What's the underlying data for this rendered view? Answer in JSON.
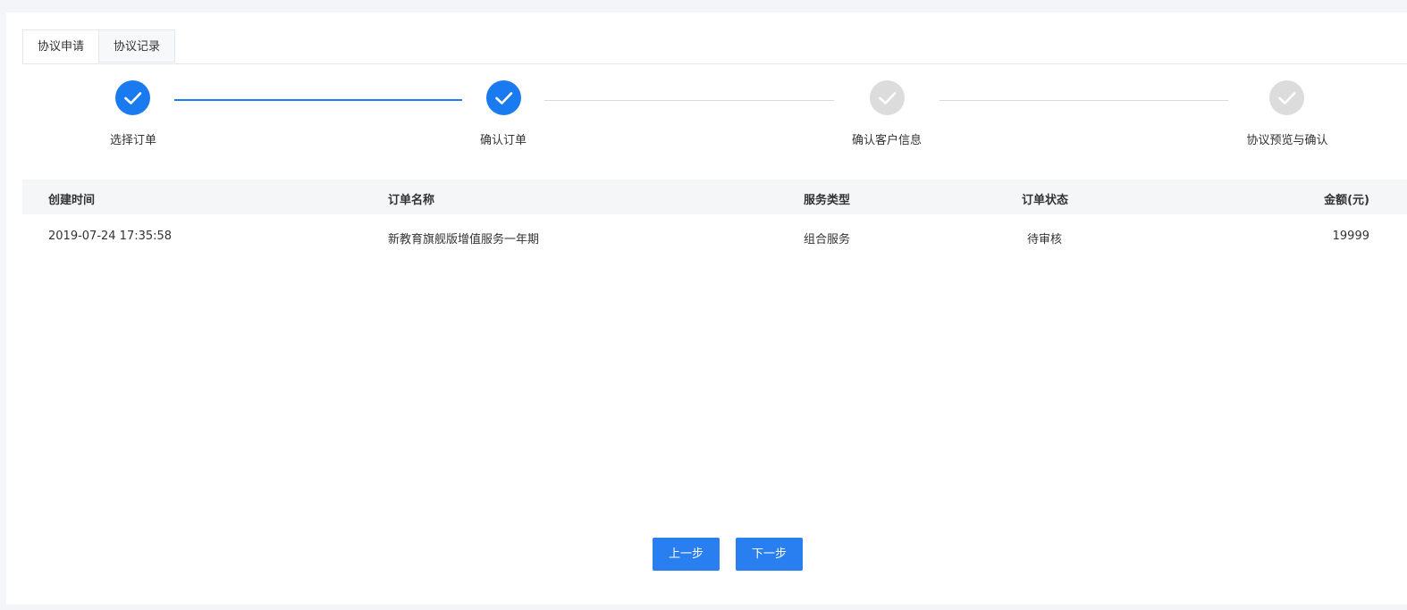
{
  "tabs": [
    {
      "label": "协议申请",
      "active": true
    },
    {
      "label": "协议记录",
      "active": false
    }
  ],
  "steps": [
    {
      "label": "选择订单",
      "status": "done"
    },
    {
      "label": "确认订单",
      "status": "done"
    },
    {
      "label": "确认客户信息",
      "status": "todo"
    },
    {
      "label": "协议预览与确认",
      "status": "todo"
    }
  ],
  "table": {
    "headers": {
      "created_time": "创建时间",
      "order_name": "订单名称",
      "service_type": "服务类型",
      "order_status": "订单状态",
      "amount": "金额(元)"
    },
    "rows": [
      {
        "created_time": "2019-07-24 17:35:58",
        "order_name": "新教育旗舰版增值服务一年期",
        "service_type": "组合服务",
        "order_status": "待审核",
        "amount": "19999"
      }
    ]
  },
  "buttons": {
    "prev_label": "上一步",
    "next_label": "下一步"
  },
  "colors": {
    "accent": "#1a7bf0",
    "button": "#2a7ff0",
    "step_inactive": "#dcdcdc",
    "table_header_bg": "#f5f6f8",
    "page_bg": "#f4f5f8"
  },
  "icons": {
    "step_done": "check-icon",
    "step_todo": "check-icon"
  }
}
